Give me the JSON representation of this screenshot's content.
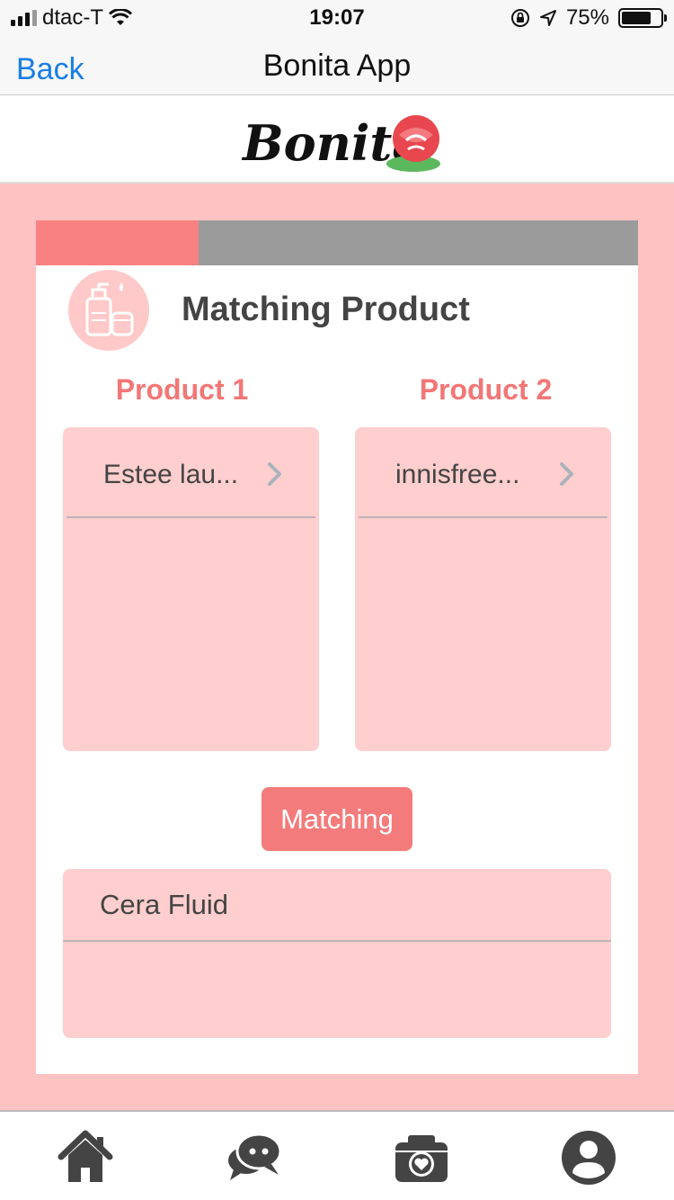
{
  "status_bar": {
    "carrier": "dtac-T",
    "time": "19:07",
    "battery": "75%",
    "battery_level": 0.75,
    "icons": [
      "signal-icon",
      "wifi-icon",
      "orientation-lock-icon",
      "location-icon",
      "battery-icon"
    ]
  },
  "nav": {
    "back_label": "Back",
    "title": "Bonita App"
  },
  "logo": {
    "text": "Bonita"
  },
  "card": {
    "progress": 0.27,
    "heading": "Matching Product",
    "heading_icon": "cosmetics-icon"
  },
  "products": [
    {
      "label": "Product 1",
      "selected": "Estee lau..."
    },
    {
      "label": "Product 2",
      "selected": "innisfree..."
    }
  ],
  "match_button": "Matching",
  "result": {
    "title": "Cera Fluid"
  },
  "tab_bar": {
    "items": [
      "home-icon",
      "chat-icon",
      "camera-icon",
      "profile-icon"
    ]
  },
  "colors": {
    "accent": "#f47b7b",
    "page_bg": "#ffc2c2",
    "panel_bg": "#ffcece",
    "link": "#1a7ee6",
    "progress_track": "#9b9b9b"
  }
}
